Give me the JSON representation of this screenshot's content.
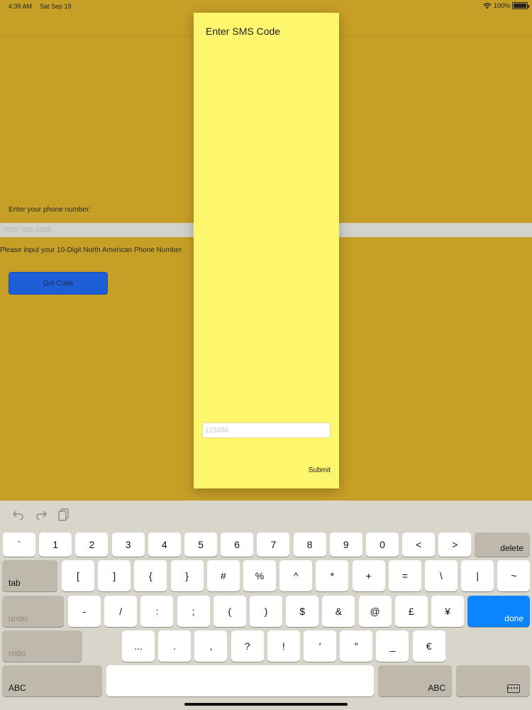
{
  "status_bar": {
    "time": "4:39 AM",
    "date": "Sat Sep 19",
    "battery": "100%"
  },
  "form": {
    "phone_label": "Enter your phone number:",
    "phone_placeholder": "(555) 555-5555",
    "phone_hint": "Please input your 10-Digit North American Phone Number",
    "get_code_label": "Get Code"
  },
  "dialog": {
    "title": "Enter SMS Code",
    "code_placeholder": "123456",
    "submit_label": "Submit"
  },
  "keyboard": {
    "toolbar": [
      "undo-icon",
      "redo-icon",
      "paste-icon"
    ],
    "row1": [
      "`",
      "1",
      "2",
      "3",
      "4",
      "5",
      "6",
      "7",
      "8",
      "9",
      "0",
      "<",
      ">"
    ],
    "row1_delete": "delete",
    "row2_tab": "tab",
    "row2": [
      "[",
      "]",
      "{",
      "}",
      "#",
      "%",
      "^",
      "*",
      "+",
      "=",
      "\\",
      "|",
      "~"
    ],
    "row3_undo": "undo",
    "row3": [
      "-",
      "/",
      ":",
      ";",
      "(",
      ")",
      "$",
      "&",
      "@",
      "£",
      "¥"
    ],
    "row3_done": "done",
    "row4_redo": "redo",
    "row4": [
      "...",
      ".",
      ",",
      "?",
      "!",
      "′",
      "″",
      "_",
      "€"
    ],
    "abc_left": "ABC",
    "abc_right": "ABC",
    "accent_color": "#0A84FF"
  }
}
